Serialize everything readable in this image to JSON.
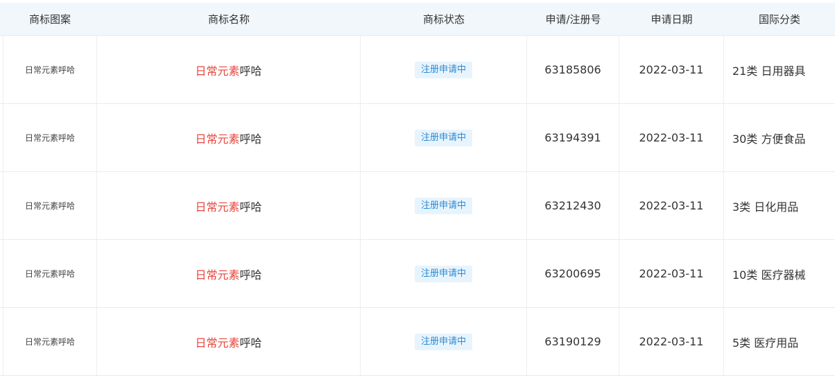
{
  "header": {
    "col_logo": "商标图案",
    "col_name": "商标名称",
    "col_status": "商标状态",
    "col_regno": "申请/注册号",
    "col_date": "申请日期",
    "col_class": "国际分类"
  },
  "colors": {
    "header_bg": "#f1f7fb",
    "highlight_red": "#e8453c",
    "badge_bg": "#e8f4fd",
    "badge_text": "#2a8ad4"
  },
  "rows": [
    {
      "logo_text": "日常元素呼哈",
      "name_highlight": "日常元素",
      "name_rest": "呼哈",
      "status": "注册申请中",
      "reg_no": "63185806",
      "date": "2022-03-11",
      "intl_class": "21类 日用器具"
    },
    {
      "logo_text": "日常元素呼哈",
      "name_highlight": "日常元素",
      "name_rest": "呼哈",
      "status": "注册申请中",
      "reg_no": "63194391",
      "date": "2022-03-11",
      "intl_class": "30类 方便食品"
    },
    {
      "logo_text": "日常元素呼哈",
      "name_highlight": "日常元素",
      "name_rest": "呼哈",
      "status": "注册申请中",
      "reg_no": "63212430",
      "date": "2022-03-11",
      "intl_class": "3类 日化用品"
    },
    {
      "logo_text": "日常元素呼哈",
      "name_highlight": "日常元素",
      "name_rest": "呼哈",
      "status": "注册申请中",
      "reg_no": "63200695",
      "date": "2022-03-11",
      "intl_class": "10类 医疗器械"
    },
    {
      "logo_text": "日常元素呼哈",
      "name_highlight": "日常元素",
      "name_rest": "呼哈",
      "status": "注册申请中",
      "reg_no": "63190129",
      "date": "2022-03-11",
      "intl_class": "5类 医疗用品"
    }
  ]
}
